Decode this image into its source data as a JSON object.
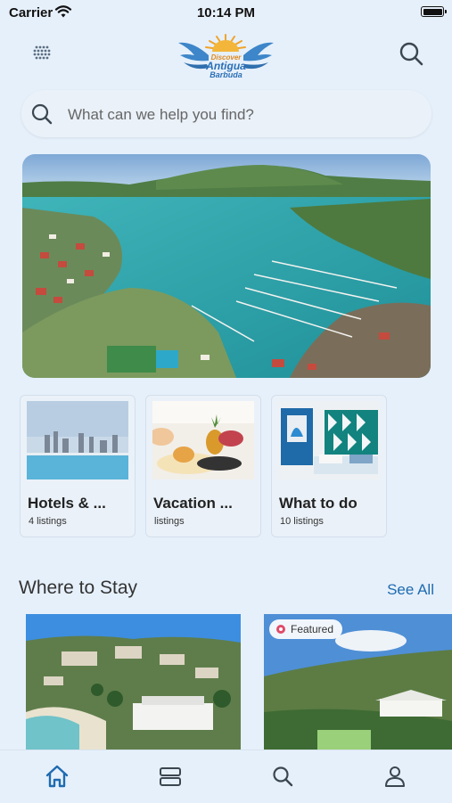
{
  "status_bar": {
    "carrier": "Carrier",
    "time": "10:14 PM"
  },
  "header": {
    "logo": {
      "line1": "Discover",
      "line2": "Antigua",
      "line3": "Barbuda"
    },
    "menu_icon": "grid-dots-icon",
    "search_icon": "search-icon"
  },
  "search": {
    "placeholder": "What can we help you find?"
  },
  "hero": {
    "image": "aerial-marina-photo"
  },
  "categories": [
    {
      "title": "Hotels & ...",
      "count": "4 listings"
    },
    {
      "title": "Vacation ...",
      "count": "listings"
    },
    {
      "title": "What to do",
      "count": "10 listings"
    }
  ],
  "where_to_stay": {
    "title": "Where to Stay",
    "see_all": "See All",
    "cards": [
      {
        "badge": ""
      },
      {
        "badge": "Featured"
      }
    ]
  },
  "tabbar": {
    "items": [
      "home-icon",
      "listings-icon",
      "search-icon",
      "profile-icon"
    ],
    "active_color": "#1e6bb0",
    "inactive_color": "#3a4650"
  }
}
